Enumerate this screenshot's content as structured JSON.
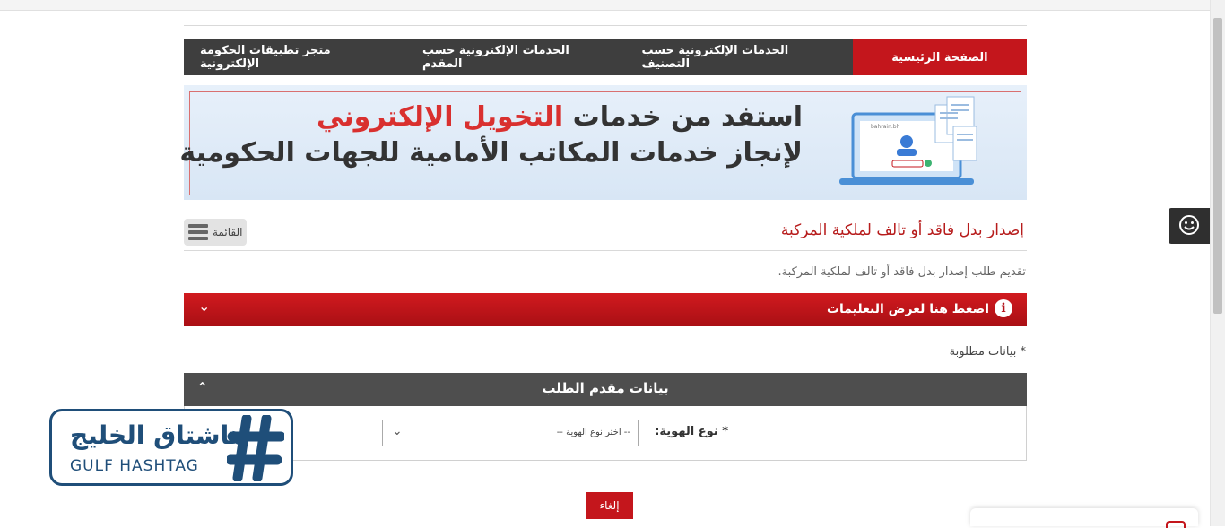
{
  "nav": {
    "items": [
      {
        "label": "الصفحة الرئيسية",
        "active": true
      },
      {
        "label": "الخدمات الإلكترونية حسب التصنيف"
      },
      {
        "label": "الخدمات الإلكترونية حسب المقدم"
      },
      {
        "label": "متجر تطبيقات الحكومة الإلكترونية"
      }
    ]
  },
  "banner": {
    "line1_start": "استفد من خدمات ",
    "line1_accent": "التخويل الإلكتروني",
    "line2": "لإنجاز خدمات المكاتب الأمامية للجهات الحكومية",
    "screen_label": "bahrain.bh"
  },
  "menu_button": {
    "label": "القائمة"
  },
  "page": {
    "title": "إصدار بدل فاقد أو تالف لملكية المركبة",
    "description": "تقديم طلب إصدار بدل فاقد أو تالف لملكية المركبة."
  },
  "instructions": {
    "label": "اضغط هنا لعرض التعليمات",
    "info_glyph": "i"
  },
  "required_note": "* بيانات مطلوبة",
  "applicant_section": {
    "title": "بيانات مقدم الطلب",
    "id_type_label": "* نوع الهوية:",
    "id_type_selected": "-- اختر نوع الهوية --"
  },
  "cancel_button": {
    "label": "إلغاء"
  },
  "watermark": {
    "arabic": "هاشتاق الخليج",
    "english": "GULF HASHTAG"
  },
  "colors": {
    "primary_red": "#c4161c",
    "nav_dark": "#3e3e3e",
    "section_head": "#4e4e4e",
    "logo_blue": "#1f4e79"
  }
}
